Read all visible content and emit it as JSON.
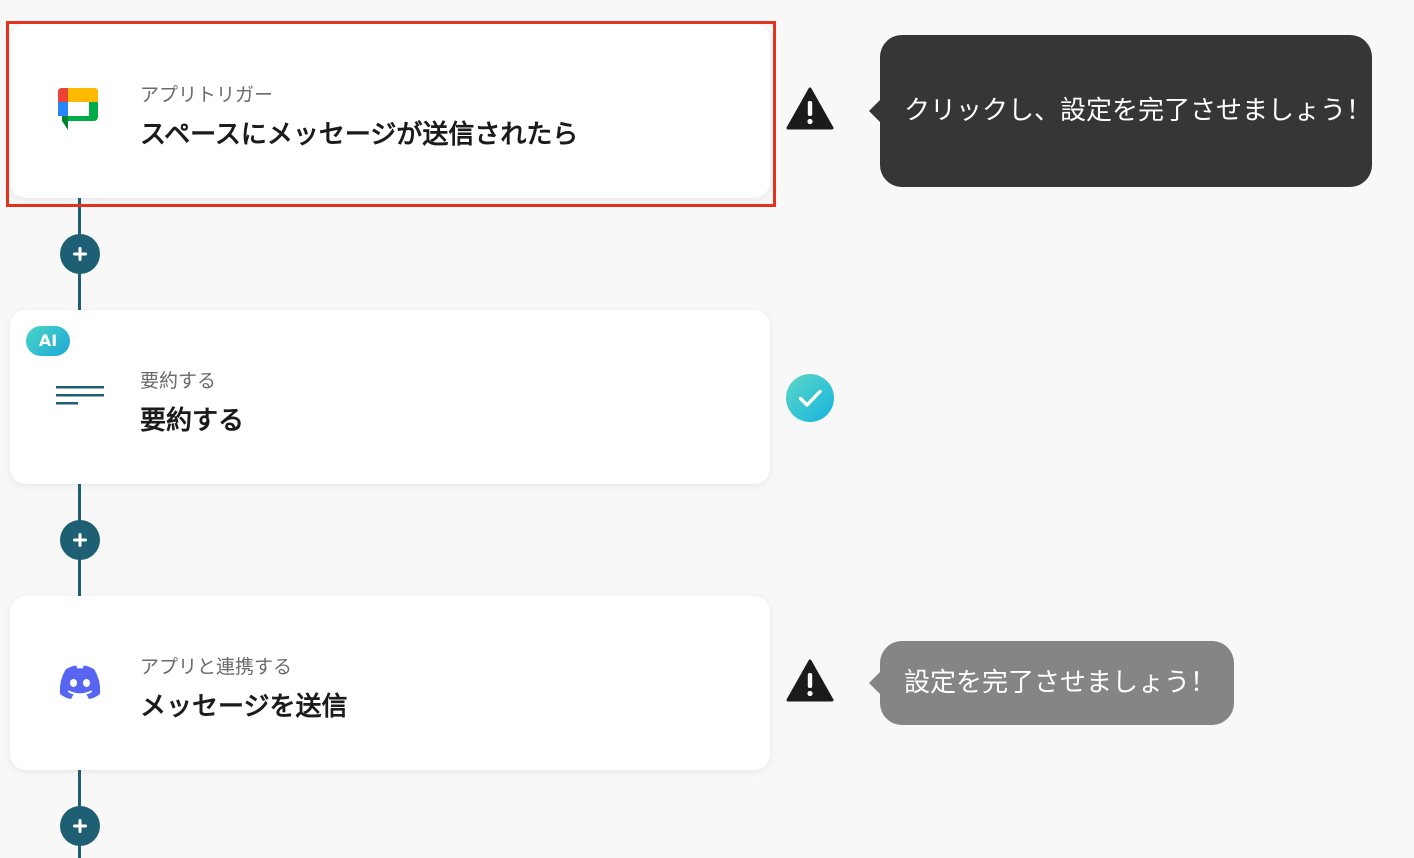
{
  "steps": [
    {
      "subtitle": "アプリトリガー",
      "title": "スペースにメッセージが送信されたら",
      "icon": "google-chat-icon",
      "status": "warning"
    },
    {
      "badge": "AI",
      "subtitle": "要約する",
      "title": "要約する",
      "icon": "text-lines-icon",
      "status": "complete"
    },
    {
      "subtitle": "アプリと連携する",
      "title": "メッセージを送信",
      "icon": "discord-icon",
      "status": "warning"
    }
  ],
  "tooltips": {
    "primary": "クリックし、設定を完了させましょう！",
    "secondary": "設定を完了させましょう！"
  },
  "colors": {
    "connector": "#1f5f73",
    "highlight": "#e3321d",
    "ai_badge": "#1ca8d6",
    "check": "#25c3d3",
    "discord": "#5865f2"
  }
}
